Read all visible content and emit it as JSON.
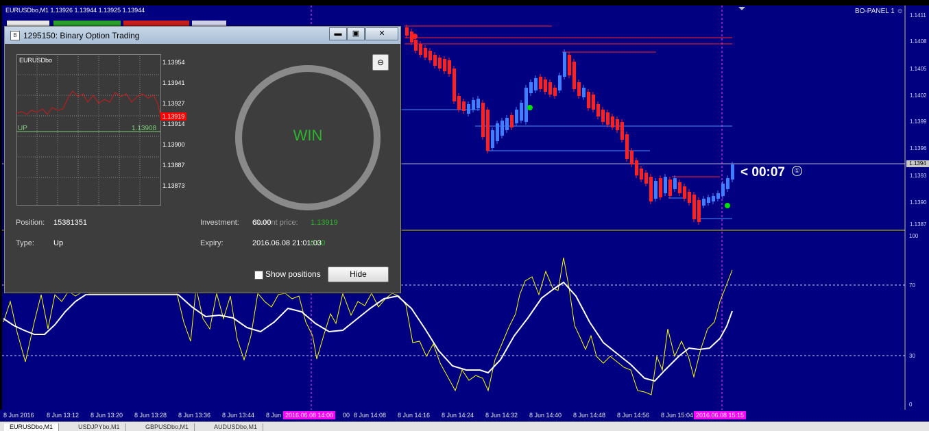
{
  "chart": {
    "title": "EURUSDbo,M1  1.13926 1.13944 1.13925 1.13944",
    "panel_label": "BO-PANEL 1",
    "current_price": "1.1394",
    "countdown": "< 00:07",
    "countdown_icon": "①",
    "price_labels": [
      "1.1411",
      "1.1408",
      "1.1405",
      "1.1402",
      "1.1399",
      "1.1396",
      "1.1393",
      "1.1390",
      "1.1387"
    ],
    "oscillator_labels": [
      "100",
      "70",
      "30",
      "0"
    ],
    "time_labels": [
      "8 Jun 2016",
      "8 Jun 13:12",
      "8 Jun 13:20",
      "8 Jun 13:28",
      "8 Jun 13:36",
      "8 Jun 13:44",
      "8 Jun",
      "00",
      "8 Jun 14:08",
      "8 Jun 14:16",
      "8 Jun 14:24",
      "8 Jun 14:32",
      "8 Jun 14:40",
      "8 Jun 14:48",
      "8 Jun 14:56",
      "8 Jun 15:04"
    ],
    "highlight_times": [
      "2016.06.08 14:00",
      "2016.06.08 15:15"
    ],
    "colors": {
      "background": "#000080",
      "bull": "#3f7fff",
      "bear": "#ff2020",
      "line_main": "#ffffff",
      "line_fast": "#ffff00"
    }
  },
  "tabs": [
    "EURUSDbo,M1",
    "USDJPYbo,M1",
    "GBPUSDbo,M1",
    "AUDUSDbo,M1"
  ],
  "dialog": {
    "title": "1295150: Binary Option Trading",
    "icon_text": "B",
    "window_buttons": {
      "minimize": "▬",
      "maximize": "▣",
      "close": "✕"
    },
    "back_button_icon": "⊖",
    "mini_chart": {
      "symbol": "EURUSDbo",
      "prices": [
        "1.13954",
        "1.13941",
        "1.13927",
        "1.13914",
        "1.13900",
        "1.13887",
        "1.13873"
      ],
      "current": "1.13919",
      "up_label": "UP",
      "up_value": "1.13908"
    },
    "result": "WIN",
    "position_label": "Position:",
    "position_value": "15381351",
    "type_label": "Type:",
    "type_value": "Up",
    "investment_label": "Investment:",
    "investment_value": "60.00",
    "current_price_label": "Current price:",
    "current_price_value": "1.13919",
    "expiry_label": "Expiry:",
    "expiry_value": "2016.06.08 21:01:03",
    "profit_value": "0.00",
    "show_positions": "Show positions",
    "hide_button": "Hide"
  }
}
